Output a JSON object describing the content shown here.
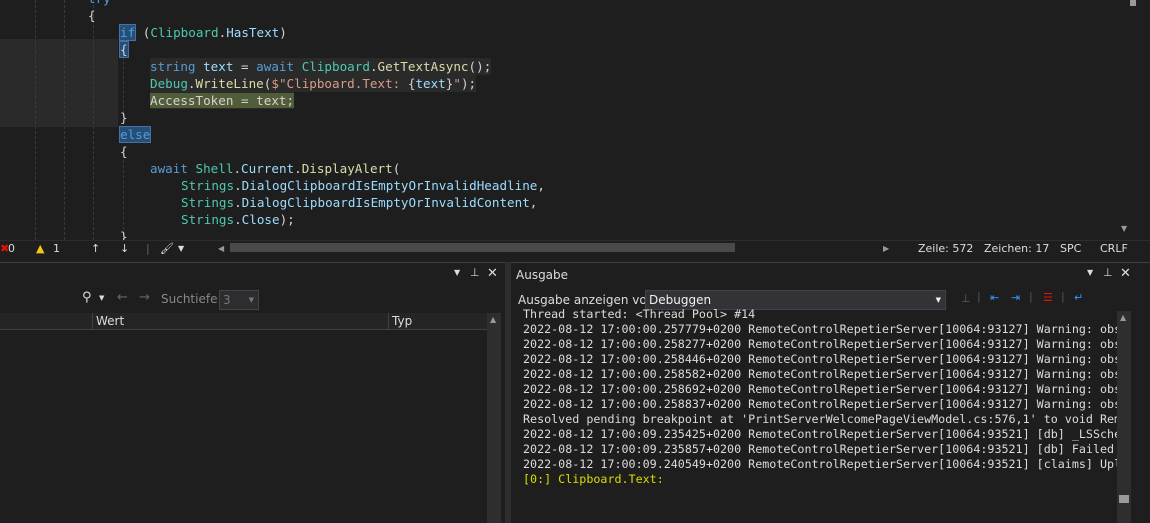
{
  "editor": {
    "lines": [
      [
        {
          "t": "try",
          "c": "k"
        }
      ],
      [
        {
          "t": "{",
          "c": "p"
        }
      ],
      [
        {
          "t": "if",
          "c": "k bm"
        },
        {
          "t": " (",
          "c": "p"
        },
        {
          "t": "Clipboard",
          "c": "t"
        },
        {
          "t": ".",
          "c": "p"
        },
        {
          "t": "HasText",
          "c": "v"
        },
        {
          "t": ")",
          "c": "p"
        }
      ],
      [
        {
          "t": "{",
          "c": "p bm"
        }
      ],
      [
        {
          "t": "string",
          "c": "k"
        },
        {
          "t": " text ",
          "c": "v"
        },
        {
          "t": "= ",
          "c": "p"
        },
        {
          "t": "await",
          "c": "k"
        },
        {
          "t": " ",
          "c": "p"
        },
        {
          "t": "Clipboard",
          "c": "t"
        },
        {
          "t": ".",
          "c": "p"
        },
        {
          "t": "GetTextAsync",
          "c": "m"
        },
        {
          "t": "();",
          "c": "p"
        }
      ],
      [
        {
          "t": "Debug",
          "c": "t"
        },
        {
          "t": ".",
          "c": "p"
        },
        {
          "t": "WriteLine",
          "c": "m"
        },
        {
          "t": "(",
          "c": "p"
        },
        {
          "t": "$\"Clipboard.Text: ",
          "c": "s"
        },
        {
          "t": "{",
          "c": "p"
        },
        {
          "t": "text",
          "c": "v"
        },
        {
          "t": "}",
          "c": "p"
        },
        {
          "t": "\"",
          "c": "s"
        },
        {
          "t": ");",
          "c": "p"
        }
      ],
      [
        {
          "t": "AccessToken = text;",
          "c": "p hlat"
        }
      ],
      [
        {
          "t": "}",
          "c": "p"
        }
      ],
      [
        {
          "t": "else",
          "c": "k bm"
        }
      ],
      [
        {
          "t": "{",
          "c": "p"
        }
      ],
      [
        {
          "t": "await",
          "c": "k"
        },
        {
          "t": " ",
          "c": "p"
        },
        {
          "t": "Shell",
          "c": "t"
        },
        {
          "t": ".",
          "c": "p"
        },
        {
          "t": "Current",
          "c": "v"
        },
        {
          "t": ".",
          "c": "p"
        },
        {
          "t": "DisplayAlert",
          "c": "m"
        },
        {
          "t": "(",
          "c": "p"
        }
      ],
      [
        {
          "t": "Strings",
          "c": "t"
        },
        {
          "t": ".",
          "c": "p"
        },
        {
          "t": "DialogClipboardIsEmptyOrInvalidHeadline",
          "c": "v"
        },
        {
          "t": ",",
          "c": "p"
        }
      ],
      [
        {
          "t": "Strings",
          "c": "t"
        },
        {
          "t": ".",
          "c": "p"
        },
        {
          "t": "DialogClipboardIsEmptyOrInvalidContent",
          "c": "v"
        },
        {
          "t": ",",
          "c": "p"
        }
      ],
      [
        {
          "t": "Strings",
          "c": "t"
        },
        {
          "t": ".",
          "c": "p"
        },
        {
          "t": "Close",
          "c": "v"
        },
        {
          "t": ");",
          "c": "p"
        }
      ],
      [
        {
          "t": "}",
          "c": "p"
        }
      ]
    ]
  },
  "status": {
    "errors": "0",
    "warnings": "1",
    "line": "Zeile: 572",
    "col": "Zeichen: 17",
    "spc": "SPC",
    "crlf": "CRLF"
  },
  "locals": {
    "search_depth_label": "Suchtiefe:",
    "search_depth_value": "3",
    "col_value": "Wert",
    "col_type": "Typ"
  },
  "output": {
    "title": "Ausgabe",
    "show_label": "Ausgabe anzeigen von:",
    "show_value": "Debuggen",
    "lines": [
      "Thread started: <Thread Pool> #14",
      "2022-08-12 17:00:00.257779+0200 RemoteControlRepetierServer[10064:93127] Warning: obs",
      "2022-08-12 17:00:00.258277+0200 RemoteControlRepetierServer[10064:93127] Warning: obs",
      "2022-08-12 17:00:00.258446+0200 RemoteControlRepetierServer[10064:93127] Warning: obs",
      "2022-08-12 17:00:00.258582+0200 RemoteControlRepetierServer[10064:93127] Warning: obs",
      "2022-08-12 17:00:00.258692+0200 RemoteControlRepetierServer[10064:93127] Warning: obs",
      "2022-08-12 17:00:00.258837+0200 RemoteControlRepetierServer[10064:93127] Warning: obs",
      "Resolved pending breakpoint at 'PrintServerWelcomePageViewModel.cs:576,1' to void Rem",
      "2022-08-12 17:00:09.235425+0200 RemoteControlRepetierServer[10064:93521] [db] _LSSche",
      "2022-08-12 17:00:09.235857+0200 RemoteControlRepetierServer[10064:93521] [db] Failed",
      "2022-08-12 17:00:09.240549+0200 RemoteControlRepetierServer[10064:93521] [claims] Upl"
    ],
    "last_line": "[0:] Clipboard.Text:"
  },
  "colors": {
    "accent": "#569cd6",
    "bg": "#1e1e1e",
    "output_highlight": "#dcdc00"
  }
}
